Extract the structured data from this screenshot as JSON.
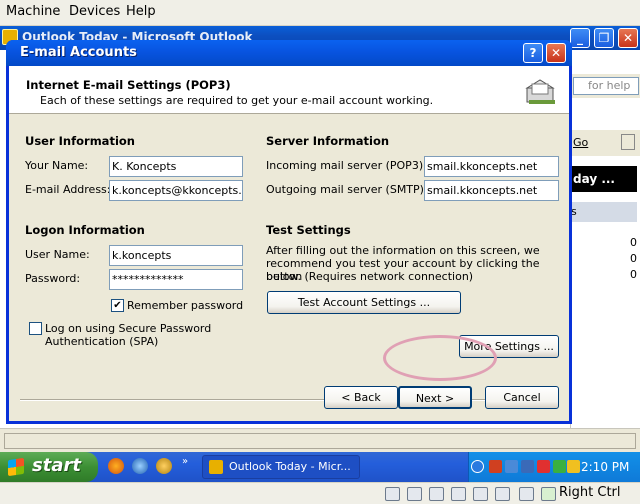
{
  "vm_menu": {
    "items": [
      "Machine",
      "Devices",
      "Help"
    ]
  },
  "outlook": {
    "title": "Outlook Today - Microsoft Outlook",
    "help_placeholder": "for help",
    "go_label": "Go",
    "today_label": "day ...",
    "s_label": "s",
    "counts": [
      "0",
      "0",
      "0"
    ]
  },
  "dialog": {
    "title": "E-mail Accounts",
    "help_btn": "?",
    "close_btn": "✕",
    "header_title": "Internet E-mail Settings (POP3)",
    "header_subtitle": "Each of these settings are required to get your e-mail account working.",
    "user_info": {
      "heading": "User Information",
      "name_label": "Your Name:",
      "name_value": "K. Koncepts",
      "email_label": "E-mail Address:",
      "email_value": "k.koncepts@kkoncepts.net"
    },
    "server_info": {
      "heading": "Server Information",
      "incoming_label": "Incoming mail server (POP3):",
      "incoming_value": "smail.kkoncepts.net",
      "outgoing_label": "Outgoing mail server (SMTP):",
      "outgoing_value": "smail.kkoncepts.net"
    },
    "logon_info": {
      "heading": "Logon Information",
      "user_label": "User Name:",
      "user_value": "k.koncepts",
      "password_label": "Password:",
      "password_value": "*************",
      "remember_label": "Remember password",
      "remember_checked": true,
      "spa_label_line1": "Log on using Secure Password",
      "spa_label_line2": "Authentication (SPA)",
      "spa_checked": false
    },
    "test_settings": {
      "heading": "Test Settings",
      "desc_line1": "After filling out the information on this screen, we",
      "desc_line2": "recommend you test your account by clicking the button",
      "desc_line3": "below. (Requires network connection)",
      "test_button": "Test Account Settings ..."
    },
    "more_settings_button": "More Settings ...",
    "back_button": "< Back",
    "next_button": "Next >",
    "cancel_button": "Cancel"
  },
  "taskbar": {
    "start_label": "start",
    "task_label": "Outlook Today - Micr...",
    "clock": "2:10 PM"
  },
  "vm_status": {
    "host_key": "Right Ctrl"
  },
  "colors": {
    "xp_title": "#0a5fd8",
    "start_green": "#3c8f34",
    "dialog_face": "#ece9d8",
    "highlight": "#e0a0b4"
  }
}
